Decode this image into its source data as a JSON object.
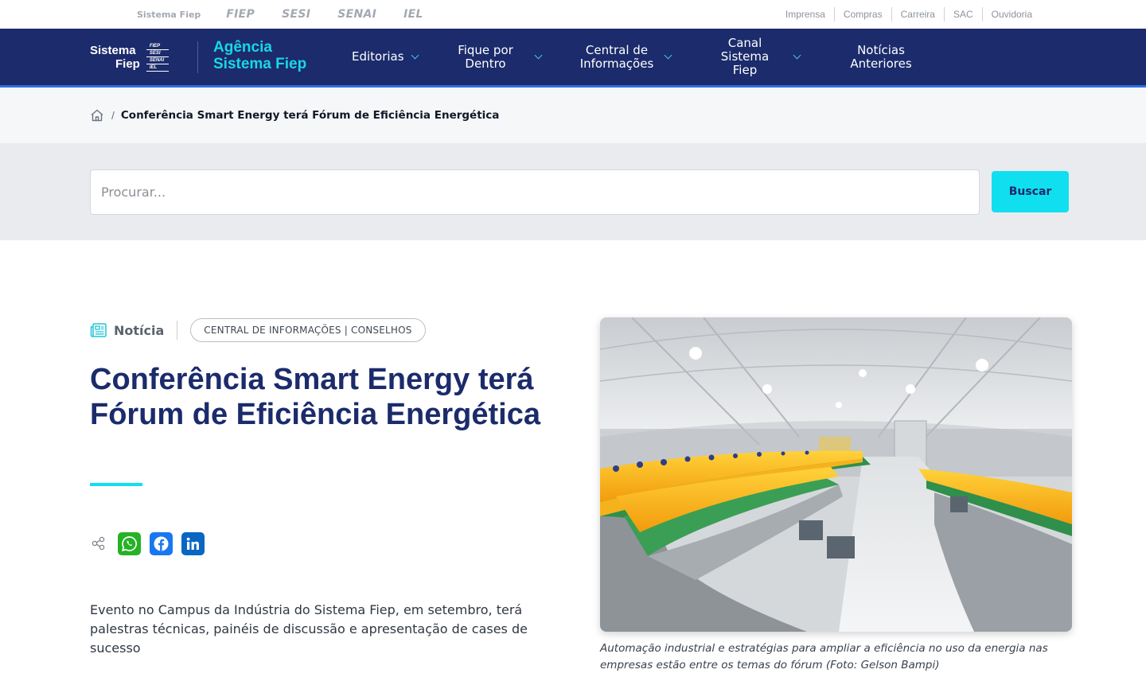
{
  "topbar": {
    "brands": [
      "Sistema Fiep",
      "FIEP",
      "SESI",
      "SENAI",
      "IEL"
    ],
    "links": [
      "Imprensa",
      "Compras",
      "Carreira",
      "SAC",
      "Ouvidoria"
    ]
  },
  "navbar": {
    "logo_line1": "Sistema",
    "logo_line2": "Fiep",
    "logo_mini": [
      "FIEP",
      "SESI",
      "SENAI",
      "IEL"
    ],
    "agencia_line1": "Agência",
    "agencia_line2": "Sistema Fiep",
    "items": [
      {
        "label1": "Editorias",
        "label2": ""
      },
      {
        "label1": "Fique por",
        "label2": "Dentro"
      },
      {
        "label1": "Central de",
        "label2": "Informações"
      },
      {
        "label1": "Canal Sistema",
        "label2": "Fiep"
      },
      {
        "label1": "Notícias",
        "label2": "Anteriores"
      }
    ]
  },
  "breadcrumb": {
    "separator": "/",
    "current": "Conferência Smart Energy terá Fórum de Eficiência Energética"
  },
  "search": {
    "placeholder": "Procurar...",
    "button_label": "Buscar"
  },
  "article": {
    "type": "Notícia",
    "tag": "CENTRAL DE INFORMAÇÕES | CONSELHOS",
    "title": "Conferência Smart Energy terá Fórum de Eficiência Energética",
    "lead": "Evento no Campus da Indústria do Sistema Fiep, em setembro, terá palestras técnicas, painéis de discussão e apresentação de cases de sucesso",
    "caption": "Automação industrial e estratégias para ampliar a eficiência no uso da energia nas empresas estão entre os temas do fórum (Foto: Gelson Bampi)"
  },
  "social": {
    "whatsapp_color": "#25b225",
    "facebook_color": "#1877f2",
    "linkedin_color": "#0a66c2"
  },
  "colors": {
    "navy": "#1b2b6b",
    "cyan": "#10dff0"
  }
}
